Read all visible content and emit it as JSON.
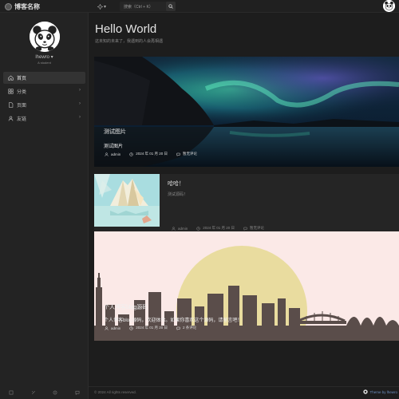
{
  "header": {
    "site_name": "博客名称",
    "search_placeholder": "搜索（Ctrl + K）",
    "theme_toggle_icon": "sun-icon",
    "theme_toggle_caret": "▾"
  },
  "sidebar": {
    "user_name": "lhewro",
    "user_caret": "▾",
    "user_bio": "A student",
    "items": [
      {
        "label": "首页",
        "icon": "home-icon",
        "active": true,
        "has_children": false
      },
      {
        "label": "分类",
        "icon": "grid-icon",
        "active": false,
        "has_children": true
      },
      {
        "label": "页面",
        "icon": "page-icon",
        "active": false,
        "has_children": true
      },
      {
        "label": "友链",
        "icon": "user-icon",
        "active": false,
        "has_children": true
      }
    ],
    "chevron": "›",
    "footer_icons": [
      "rss-icon",
      "tag-icon",
      "settings-icon",
      "comment-icon"
    ]
  },
  "main": {
    "title": "Hello World",
    "subtitle": "这未知的未来了，我遇到的人会再相遇"
  },
  "posts": [
    {
      "title": "测试图片",
      "excerpt": "测试图片",
      "author": "admin",
      "date": "2024 年 01 月 20 日",
      "comments": "暂无评论"
    },
    {
      "title": "哈哈！",
      "excerpt": "测试源码！",
      "author": "admin",
      "date": "2024 年 01 月 20 日",
      "comments": "暂无评论"
    },
    {
      "title": "个人博客blog源码",
      "excerpt": "个人博客blog源码，欢迎体验。如果你喜欢这个源码，请留言吧！",
      "author": "admin",
      "date": "2024 年 01 月 20 日",
      "comments": "2 条评论"
    }
  ],
  "footer": {
    "copyright": "© 2024 All rights reserved.",
    "theme_credit": "Theme by lhewro"
  },
  "colors": {
    "background": "#1a1a1a",
    "sidebar": "#232323",
    "accent_link": "#6c8ebf",
    "sun": "#e9dc9f"
  }
}
